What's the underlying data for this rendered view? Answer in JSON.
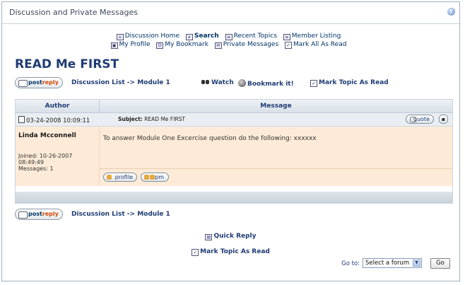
{
  "window": {
    "title": "Discussion and Private Messages",
    "help_icon": "?"
  },
  "topnav": {
    "row1": [
      {
        "icon": "home-icon",
        "label": "Discussion Home"
      },
      {
        "icon": "search-icon",
        "label": "Search"
      },
      {
        "icon": "recent-topics-icon",
        "label": "Recent Topics"
      },
      {
        "icon": "member-listing-icon",
        "label": "Member Listing"
      }
    ],
    "row2": [
      {
        "icon": "profile-icon",
        "label": "My Profile"
      },
      {
        "icon": "bookmark-icon",
        "label": "My Bookmark"
      },
      {
        "icon": "private-messages-icon",
        "label": "Private Messages"
      },
      {
        "icon": "checkbox-icon",
        "label": "Mark All As Read"
      }
    ]
  },
  "topic": {
    "title": "READ Me FIRST",
    "postreply_label_a": "post",
    "postreply_label_b": "reply",
    "breadcrumb": "Discussion List -> Module 1",
    "watch": "Watch",
    "bookmark": "Bookmark it!",
    "mark_read": "Mark Topic As Read"
  },
  "table": {
    "col_author": "Author",
    "col_message": "Message",
    "post": {
      "date": "03-24-2008 10:09:11",
      "subject_label": "Subject:",
      "subject": "READ Me FIRST",
      "quote": "quote",
      "author": "Linda Mcconnell",
      "joined": "Joined: 10-26-2007",
      "joined_time": "08:49:49",
      "messages": "Messages: 1",
      "text": "To answer Module One Excercise question do the following: xxxxxx",
      "profile": "profile",
      "pm": "pm"
    }
  },
  "footer": {
    "quick_reply": "Quick Reply",
    "mark_read": "Mark Topic As Read",
    "goto_label": "Go to:",
    "goto_selected": "Select a forum",
    "go_button": "Go"
  },
  "colors": {
    "post_body_bg": "#fdebd8",
    "accent_text": "#1f3c74",
    "reply_orange": "#d24a00"
  }
}
